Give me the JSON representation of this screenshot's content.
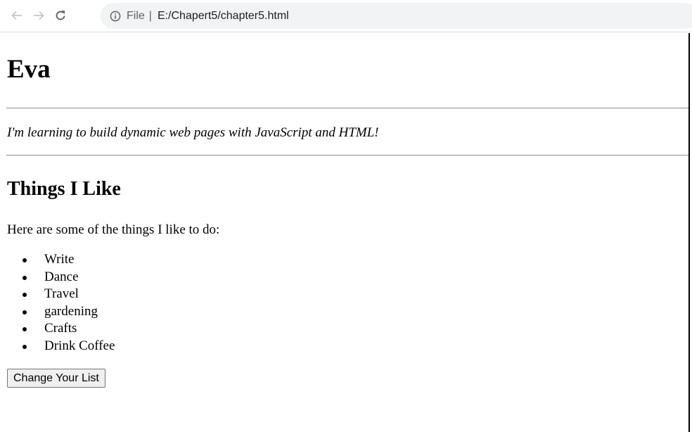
{
  "browser": {
    "scheme_label": "File",
    "separator": "|",
    "url": "E:/Chapert5/chapter5.html"
  },
  "icons": {
    "back": "back-arrow-icon",
    "forward": "forward-arrow-icon",
    "reload": "reload-icon",
    "info": "info-icon"
  },
  "page": {
    "title": "Eva",
    "tagline": "I'm learning to build dynamic web pages with JavaScript and HTML!",
    "section_heading": "Things I Like",
    "intro": "Here are some of the things I like to do:",
    "likes": [
      "Write",
      "Dance",
      "Travel",
      "gardening",
      "Crafts",
      "Drink Coffee"
    ],
    "button_label": "Change Your List"
  },
  "colors": {
    "address_bar_bg": "#f1f3f4",
    "nav_icon": "#5f6368",
    "rule": "#9a9a9a"
  }
}
